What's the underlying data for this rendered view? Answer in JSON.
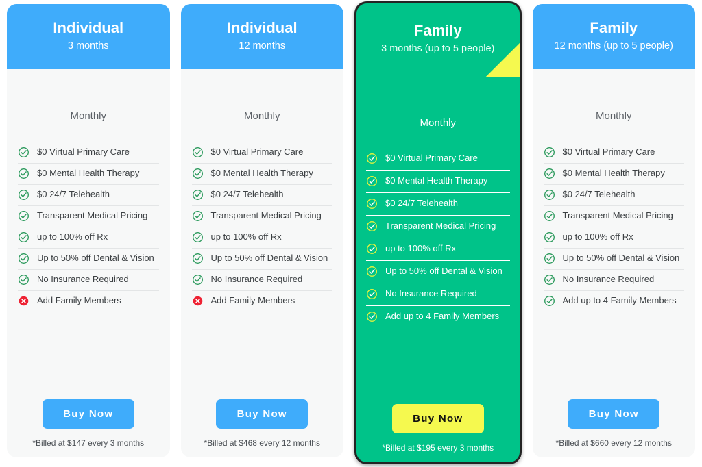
{
  "colors": {
    "header_blue": "#3facfb",
    "featured_green": "#00c389",
    "ribbon_yellow": "#f5f94f",
    "card_background": "#f7f8f8",
    "check_green": "#2e9b5e",
    "check_yellow": "#e8f43c",
    "cross_red": "#ee2233",
    "featured_border": "#242424"
  },
  "icons": {
    "check": "check-circle-icon",
    "cross": "cross-circle-icon",
    "ribbon": "featured-ribbon"
  },
  "cards": [
    {
      "plan_name": "Individual",
      "plan_term": "3 months",
      "cadence": "Monthly",
      "featured": false,
      "features": [
        {
          "label": "$0 Virtual Primary Care",
          "included": true
        },
        {
          "label": "$0 Mental Health Therapy",
          "included": true
        },
        {
          "label": "$0 24/7 Telehealth",
          "included": true
        },
        {
          "label": "Transparent Medical Pricing",
          "included": true
        },
        {
          "label": "up to 100% off Rx",
          "included": true
        },
        {
          "label": "Up to 50% off Dental & Vision",
          "included": true
        },
        {
          "label": "No Insurance Required",
          "included": true
        },
        {
          "label": "Add Family Members",
          "included": false
        }
      ],
      "cta_label": "Buy Now",
      "billing_note": "*Billed at $147 every 3 months"
    },
    {
      "plan_name": "Individual",
      "plan_term": "12 months",
      "cadence": "Monthly",
      "featured": false,
      "features": [
        {
          "label": "$0 Virtual Primary Care",
          "included": true
        },
        {
          "label": "$0 Mental Health Therapy",
          "included": true
        },
        {
          "label": "$0 24/7 Telehealth",
          "included": true
        },
        {
          "label": "Transparent Medical Pricing",
          "included": true
        },
        {
          "label": "up to 100% off Rx",
          "included": true
        },
        {
          "label": "Up to 50% off Dental & Vision",
          "included": true
        },
        {
          "label": "No Insurance Required",
          "included": true
        },
        {
          "label": "Add Family Members",
          "included": false
        }
      ],
      "cta_label": "Buy Now",
      "billing_note": "*Billed at $468 every 12 months"
    },
    {
      "plan_name": "Family",
      "plan_term": "3 months (up to 5 people)",
      "cadence": "Monthly",
      "featured": true,
      "features": [
        {
          "label": "$0 Virtual Primary Care",
          "included": true
        },
        {
          "label": "$0 Mental Health Therapy",
          "included": true
        },
        {
          "label": "$0 24/7 Telehealth",
          "included": true
        },
        {
          "label": "Transparent Medical Pricing",
          "included": true
        },
        {
          "label": "up to 100% off Rx",
          "included": true
        },
        {
          "label": "Up to 50% off Dental & Vision",
          "included": true
        },
        {
          "label": "No Insurance Required",
          "included": true
        },
        {
          "label": "Add up to 4 Family Members",
          "included": true
        }
      ],
      "cta_label": "Buy Now",
      "billing_note": "*Billed at $195 every 3 months"
    },
    {
      "plan_name": "Family",
      "plan_term": "12 months (up to 5 people)",
      "cadence": "Monthly",
      "featured": false,
      "features": [
        {
          "label": "$0 Virtual Primary Care",
          "included": true
        },
        {
          "label": "$0 Mental Health Therapy",
          "included": true
        },
        {
          "label": "$0 24/7 Telehealth",
          "included": true
        },
        {
          "label": "Transparent Medical Pricing",
          "included": true
        },
        {
          "label": "up to 100% off Rx",
          "included": true
        },
        {
          "label": "Up to 50% off Dental & Vision",
          "included": true
        },
        {
          "label": "No Insurance Required",
          "included": true
        },
        {
          "label": "Add up to 4 Family Members",
          "included": true
        }
      ],
      "cta_label": "Buy Now",
      "billing_note": "*Billed at $660 every 12 months"
    }
  ]
}
